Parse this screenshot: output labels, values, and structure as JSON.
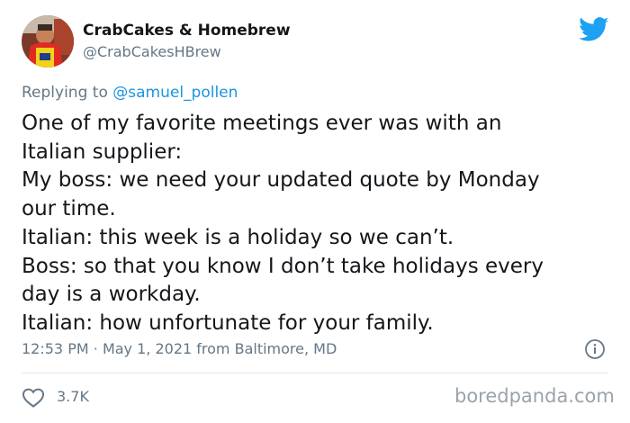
{
  "tweet": {
    "display_name": "CrabCakes & Homebrew",
    "handle": "@CrabCakesHBrew",
    "reply_prefix": "Replying to",
    "reply_to": "@samuel_pollen",
    "body_lines": [
      "One of my favorite meetings ever was with an",
      "Italian supplier:",
      "My boss: we need your updated quote by Monday",
      "our time.",
      "Italian: this week is a holiday so we can’t.",
      "Boss: so that you know I don’t take holidays every",
      "day is a workday.",
      "Italian: how unfortunate for your family."
    ],
    "time": "12:53 PM",
    "separator": "·",
    "date": "May 1, 2021",
    "source": "from Baltimore, MD",
    "likes": "3.7K"
  },
  "watermark": "boredpanda.com",
  "icons": {
    "brand": "twitter-bird-icon",
    "info": "info-icon",
    "like": "heart-icon"
  },
  "colors": {
    "twitter_blue": "#1da1f2",
    "mention": "#1b95e0",
    "secondary_text": "#657786",
    "primary_text": "#14171a"
  }
}
